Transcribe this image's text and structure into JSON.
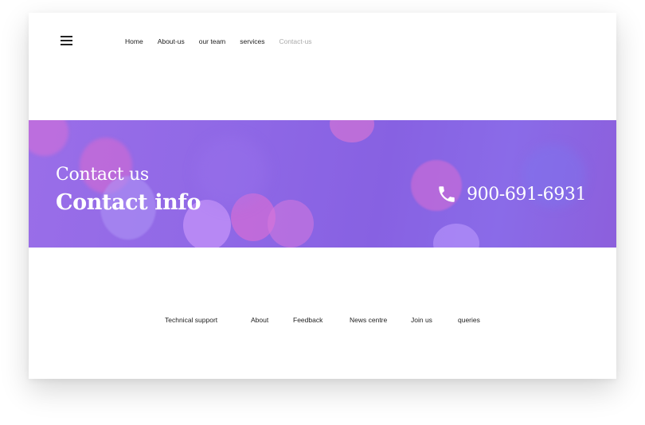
{
  "header": {
    "menu_icon": "hamburger-menu-icon",
    "nav": [
      {
        "label": "Home",
        "active": false
      },
      {
        "label": "About-us",
        "active": false
      },
      {
        "label": "our team",
        "active": false
      },
      {
        "label": "services",
        "active": false
      },
      {
        "label": "Contact-us",
        "active": true
      }
    ]
  },
  "hero": {
    "title_small": "Contact us",
    "title_big": "Contact info",
    "phone_icon": "phone-icon",
    "phone": "900-691-6931"
  },
  "footer_nav": [
    "Technical support",
    "About",
    "Feedback",
    "News centre",
    "Join us",
    "queries"
  ],
  "colors": {
    "hero_purple": "#8f68e6",
    "nav_active": "#aaaaaa",
    "text": "#222222"
  }
}
